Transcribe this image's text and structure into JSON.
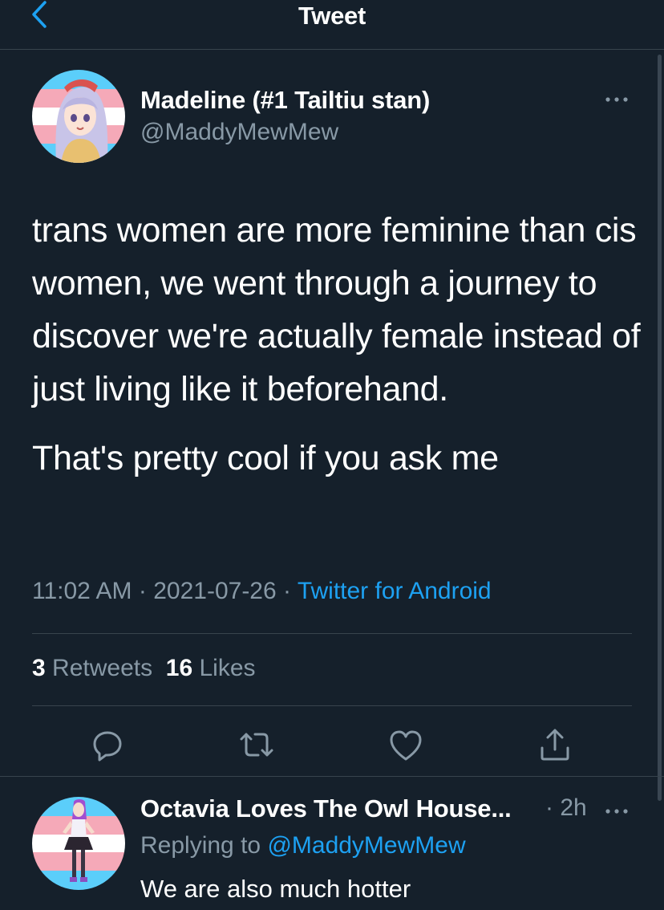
{
  "colors": {
    "background": "#15202b",
    "divider": "#38444d",
    "secondary_text": "#8899a6",
    "accent": "#1da1f2",
    "trans_blue": "#5bcefa",
    "trans_pink": "#f5a9b8",
    "trans_white": "#ffffff"
  },
  "header": {
    "title": "Tweet",
    "back_icon": "chevron-left-icon"
  },
  "tweet": {
    "author_name": "Madeline (#1 Tailtiu stan)",
    "author_handle": "@MaddyMewMew",
    "more_icon": "more-horizontal-icon",
    "paragraphs": [
      "trans women are more feminine than cis women, we went through a journey to discover we're actually female instead of just living like it beforehand.",
      "That's pretty cool if you ask me"
    ],
    "time": "11:02 AM",
    "separator": "·",
    "date": "2021-07-26",
    "source": "Twitter for Android",
    "retweet_count": "3",
    "retweet_label": "Retweets",
    "like_count": "16",
    "like_label": "Likes",
    "actions": [
      "reply-icon",
      "retweet-icon",
      "like-heart-icon",
      "share-icon"
    ]
  },
  "reply": {
    "author_name": "Octavia Loves The Owl House...",
    "time_separator": "·",
    "time": "2h",
    "replying_prefix": "Replying to",
    "replying_to": "@MaddyMewMew",
    "text": "We are also much hotter"
  }
}
